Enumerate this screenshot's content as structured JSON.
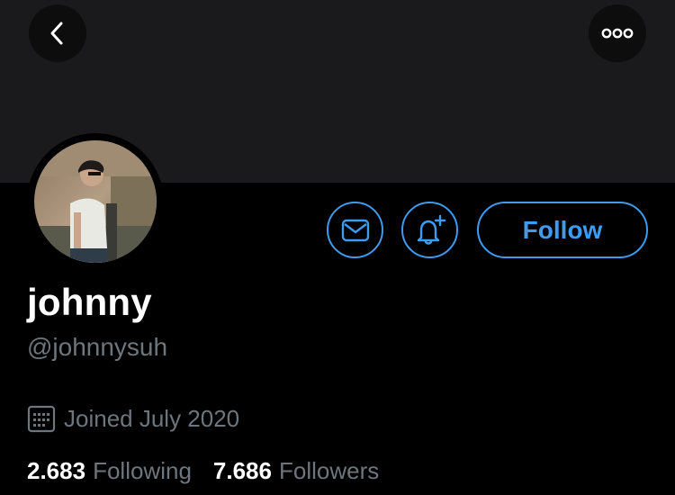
{
  "colors": {
    "accent": "#3d9bf0",
    "background": "#000000",
    "banner": "#1a1a1c",
    "secondary_text": "#6e767d"
  },
  "header": {
    "back_icon": "chevron-left-icon",
    "more_icon": "ellipsis-icon"
  },
  "profile": {
    "display_name": "johnny",
    "handle": "@johnnysuh",
    "joined_text": "Joined July 2020",
    "joined_icon": "calendar-icon"
  },
  "actions": {
    "message_icon": "mail-icon",
    "notify_icon": "bell-plus-icon",
    "follow_label": "Follow"
  },
  "stats": {
    "following_count": "2.683",
    "following_label": "Following",
    "followers_count": "7.686",
    "followers_label": "Followers"
  }
}
